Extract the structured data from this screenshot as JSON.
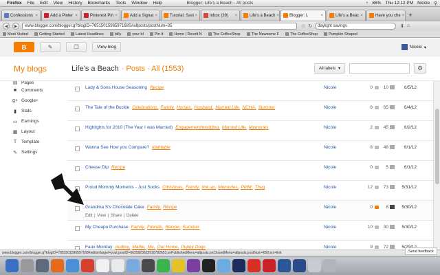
{
  "menubar": {
    "app": "Firefox",
    "menus": [
      "File",
      "Edit",
      "View",
      "History",
      "Bookmarks",
      "Tools",
      "Window",
      "Help"
    ],
    "window_title": "Blogger: Life's a Beach - All posts",
    "battery": "86%",
    "clock": "Thu 12:12 PM",
    "user": "Nicole"
  },
  "tabs": [
    {
      "label": "Confessions",
      "color": "#5a7bbf"
    },
    {
      "label": "Add a Pinter",
      "color": "#cc2127"
    },
    {
      "label": "Pinterest Pin",
      "color": "#cc2127"
    },
    {
      "label": "Add a Signat",
      "color": "#f57d00"
    },
    {
      "label": "Tutorial: Savi",
      "color": "#f57d00"
    },
    {
      "label": "Inbox (39)",
      "color": "#d44638"
    },
    {
      "label": "Life's a Beach",
      "color": "#f57d00"
    },
    {
      "label": "Blogger: L",
      "color": "#f57d00",
      "active": true
    },
    {
      "label": "Life's a Beac",
      "color": "#f57d00"
    },
    {
      "label": "Have you che",
      "color": "#f57d00"
    }
  ],
  "nav": {
    "url": "www.blogger.com/blogger.g?blogID=7851501596597168S#allposts/postNum=35",
    "search": "daylight savings"
  },
  "bookmarks": [
    "Most Visited",
    "Getting Started",
    "Latest Headlines",
    "billy",
    "your bl",
    "Pin It",
    "Home | Revolt N",
    "The CoffeeShop",
    "The Newsome F",
    "The CoffeeShop",
    "Pumpkin Shaped"
  ],
  "toolbar": {
    "view_blog": "View blog",
    "user": "Nicole"
  },
  "header": {
    "my_blogs": "My blogs",
    "blog_title": "Life's a Beach",
    "crumb": "· Posts · All (1553)",
    "labels_dropdown": "All labels"
  },
  "sidebar": [
    {
      "label": "Pages",
      "icon": "pages-icon",
      "glyph": "▤"
    },
    {
      "label": "Comments",
      "icon": "comments-icon",
      "glyph": "■"
    },
    {
      "label": "Google+",
      "icon": "google-plus-icon",
      "glyph": "g+"
    },
    {
      "label": "Stats",
      "icon": "stats-icon",
      "glyph": "▮"
    },
    {
      "label": "Earnings",
      "icon": "earnings-icon",
      "glyph": "▭"
    },
    {
      "label": "Layout",
      "icon": "layout-icon",
      "glyph": "▦"
    },
    {
      "label": "Template",
      "icon": "template-icon",
      "glyph": "T"
    },
    {
      "label": "Settings",
      "icon": "settings-icon",
      "glyph": "✎"
    }
  ],
  "posts": [
    {
      "title": "Lady & Sons House Seasoning",
      "labels": [
        "Recipe"
      ],
      "author": "Nicole",
      "comments": "0",
      "views": "10",
      "date": "6/5/12"
    },
    {
      "title": "The Tale of the Buckle",
      "labels": [
        "Celebrations,",
        "Family,",
        "Horses,",
        "Husband,",
        "Married Life,",
        "NCHA,",
        "Summer"
      ],
      "author": "Nicole",
      "comments": "8",
      "views": "65",
      "date": "6/4/12"
    },
    {
      "title": "Highlights for 2010 (The Year I was Married)",
      "labels": [
        "Engagement/wedding,",
        "Married Life,",
        "Memories"
      ],
      "author": "Nicole",
      "comments": "2",
      "views": "45",
      "date": "6/2/12"
    },
    {
      "title": "Wanna See How you Compare?",
      "labels": [
        "Idahtable"
      ],
      "author": "Nicole",
      "comments": "8",
      "views": "48",
      "date": "6/1/12"
    },
    {
      "title": "Cheese Dip",
      "labels": [
        "Recipe"
      ],
      "author": "Nicole",
      "comments": "0",
      "views": "5",
      "date": "6/1/12"
    },
    {
      "title": "Proud Mommy Moments - Just Socks",
      "labels": [
        "Christmas,",
        "Family,",
        "link up,",
        "Memories,",
        "PMM,",
        "Thug"
      ],
      "author": "Nicole",
      "comments": "12",
      "views": "73",
      "date": "5/31/12"
    },
    {
      "title": "Grandma S's Chocolate Cake",
      "labels": [
        "Family,",
        "Recipe"
      ],
      "author": "Nicole",
      "comments": "0",
      "views": "8",
      "date": "5/30/12",
      "hover": true,
      "actions": [
        "Edit",
        "View",
        "Share",
        "Delete"
      ]
    },
    {
      "title": "My Cheapo Purchase",
      "labels": [
        "Family,",
        "Friends,",
        "Recipe,",
        "Summer"
      ],
      "author": "Nicole",
      "comments": "10",
      "views": "30",
      "date": "5/30/12"
    },
    {
      "title": "Faux Monday",
      "labels": [
        "Audrey,",
        "Marlie,",
        "Me,",
        "Our Home,",
        "Puppy Dogs"
      ],
      "author": "Nicole",
      "comments": "9",
      "views": "72",
      "date": "5/29/12"
    }
  ],
  "status_url": "www.blogger.com/blogger.g?blogID=7851501596597168#editor/target=post;postID=6625923622910782653;onPublishedMenu=allposts;onClosedMenu=allposts;postNum=659;src=link",
  "feedback": "Send feedback",
  "dock_colors": [
    "#3a6fc4",
    "#9a9a9a",
    "#5f6b7a",
    "#e66a1e",
    "#4a90d9",
    "#d6402f",
    "#f0f0f0",
    "#eaeaea",
    "#7aa9e0",
    "#4a4a4a",
    "#3cb44b",
    "#e6c229",
    "#7b3fa0",
    "#222",
    "#6cace4",
    "#1c2c5c",
    "#d93025",
    "#cc2127",
    "#2b5797",
    "#2a4a8a",
    "#c8ccd2",
    "#b0b4bb"
  ]
}
